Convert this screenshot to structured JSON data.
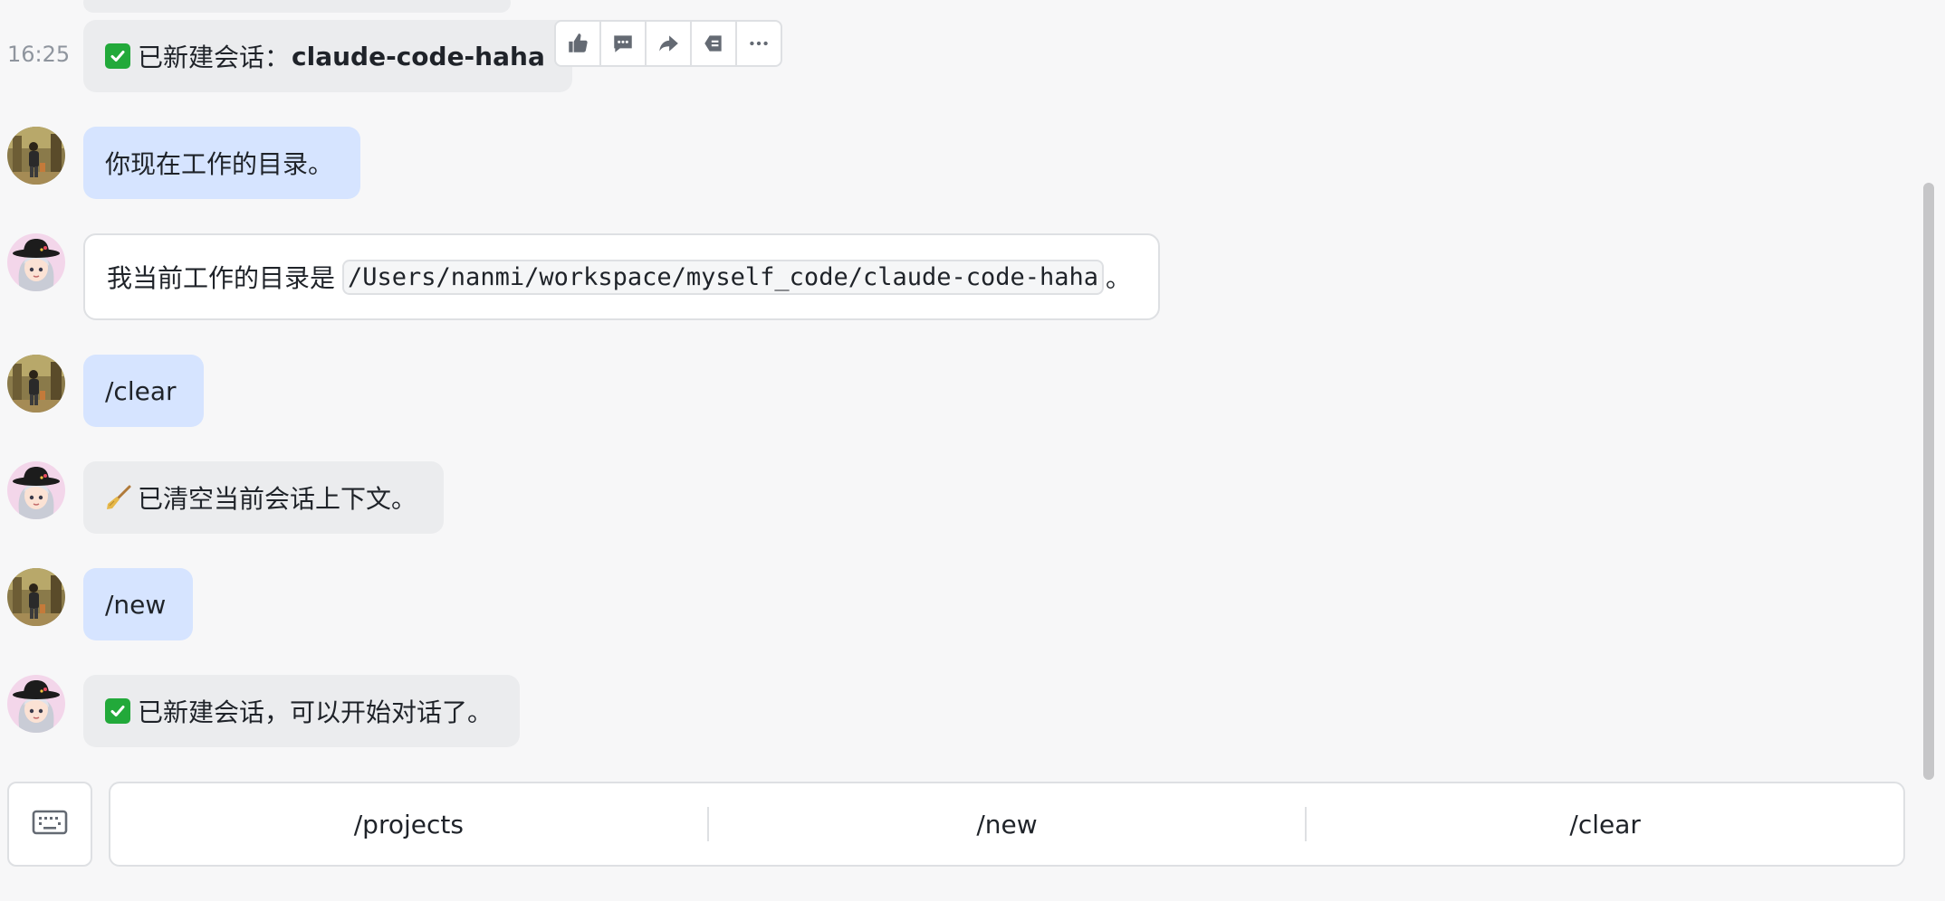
{
  "messages": {
    "m1": {
      "time": "16:25",
      "emoji": "check-mark-icon",
      "text": "已新建会话：",
      "bold": "claude-code-haha"
    },
    "m2": {
      "text": "你现在工作的目录。"
    },
    "m3": {
      "prefix": "我当前工作的目录是",
      "code": "/Users/nanmi/workspace/myself_code/claude-code-haha",
      "suffix": "。"
    },
    "m4": {
      "text": "/clear"
    },
    "m5": {
      "emoji": "broom-icon",
      "text": "已清空当前会话上下文。"
    },
    "m6": {
      "text": "/new"
    },
    "m7": {
      "emoji": "check-mark-icon",
      "text": "已新建会话，可以开始对话了。"
    }
  },
  "message_toolbar": [
    "thumbs-up-icon",
    "comment-icon",
    "share-icon",
    "quote-icon",
    "more-icon"
  ],
  "quick_commands": {
    "items": [
      {
        "label": "/projects"
      },
      {
        "label": "/new"
      },
      {
        "label": "/clear"
      }
    ]
  },
  "colors": {
    "user_bubble": "#d6e4ff",
    "bot_bubble": "#ebecee",
    "background": "#f7f7f8",
    "check_green": "#22a93a"
  }
}
